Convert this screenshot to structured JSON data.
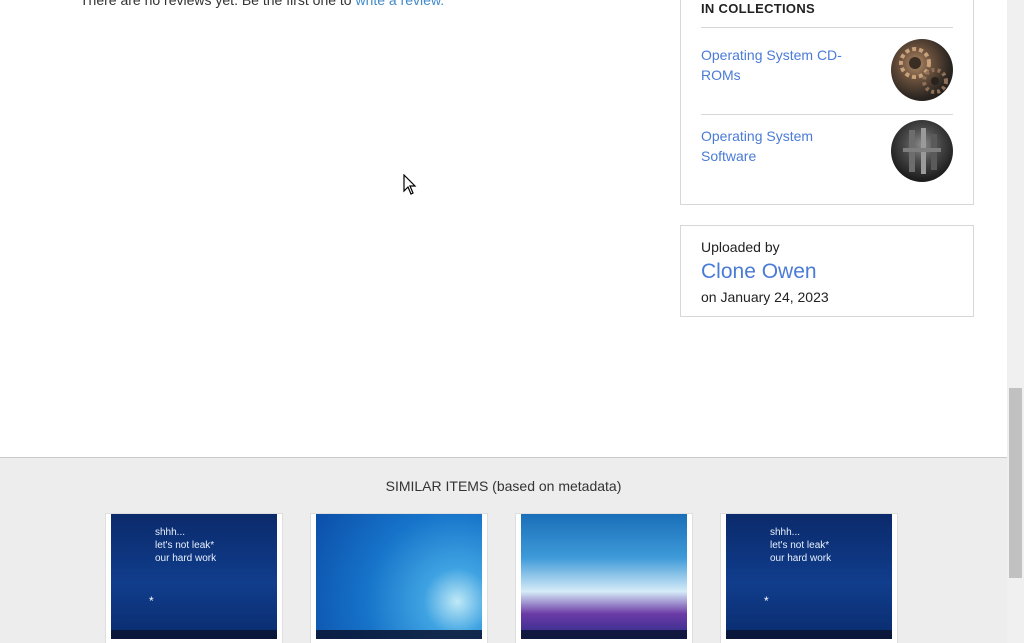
{
  "reviews": {
    "text": "There are no reviews yet. Be the first one to ",
    "link": "write a review."
  },
  "collections": {
    "heading": "IN COLLECTIONS",
    "items": [
      {
        "label": "Operating System CD-ROMs",
        "icon": "gears-thumbnail"
      },
      {
        "label": "Operating System Software",
        "icon": "machinery-thumbnail"
      }
    ]
  },
  "uploader": {
    "label": "Uploaded by",
    "name": "Clone Owen",
    "date": "on January 24, 2023"
  },
  "similar": {
    "heading": "SIMILAR ITEMS (based on metadata)",
    "items": [
      {
        "style": "leak",
        "lines": [
          "shhh...",
          "let's not leak*",
          "our hard work"
        ]
      },
      {
        "style": "desktop",
        "lines": []
      },
      {
        "style": "win8",
        "lines": []
      },
      {
        "style": "leak",
        "lines": [
          "shhh...",
          "let's not leak*",
          "our hard work"
        ]
      }
    ]
  },
  "colors": {
    "link": "#4a7bd6",
    "section_bg": "#ededed"
  }
}
